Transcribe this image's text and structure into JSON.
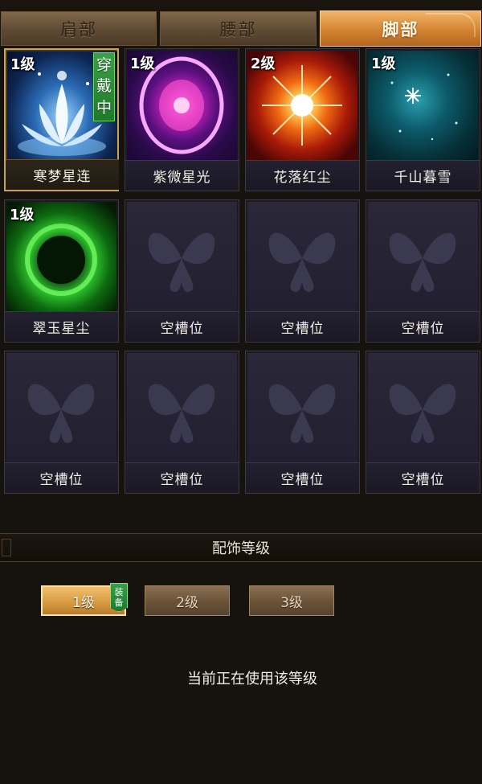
{
  "tabs": [
    {
      "label": "肩部",
      "active": false
    },
    {
      "label": "腰部",
      "active": false
    },
    {
      "label": "脚部",
      "active": true
    }
  ],
  "slots": [
    {
      "level": "1级",
      "name": "寒梦星连",
      "art": "lotus",
      "worn": true
    },
    {
      "level": "1级",
      "name": "紫微星光",
      "art": "purple-orb"
    },
    {
      "level": "2级",
      "name": "花落红尘",
      "art": "fire-burst"
    },
    {
      "level": "1级",
      "name": "千山暮雪",
      "art": "snowflake"
    },
    {
      "level": "1级",
      "name": "翠玉星尘",
      "art": "green-ring"
    },
    {
      "name": "空槽位",
      "art": "butterfly"
    },
    {
      "name": "空槽位",
      "art": "butterfly"
    },
    {
      "name": "空槽位",
      "art": "butterfly"
    },
    {
      "name": "空槽位",
      "art": "butterfly"
    },
    {
      "name": "空槽位",
      "art": "butterfly"
    },
    {
      "name": "空槽位",
      "art": "butterfly"
    },
    {
      "name": "空槽位",
      "art": "butterfly"
    }
  ],
  "worn_badge": [
    "穿",
    "戴",
    "中"
  ],
  "section": {
    "title": "配饰等级"
  },
  "level_buttons": [
    {
      "label": "1级",
      "active": true
    },
    {
      "label": "2级",
      "active": false
    },
    {
      "label": "3级",
      "active": false
    }
  ],
  "equip_tag": [
    "装",
    "备"
  ],
  "status": "当前正在使用该等级",
  "colors": {
    "active_tab": "#d38431",
    "worn_badge": "#2a8c38",
    "background": "#16120d"
  }
}
